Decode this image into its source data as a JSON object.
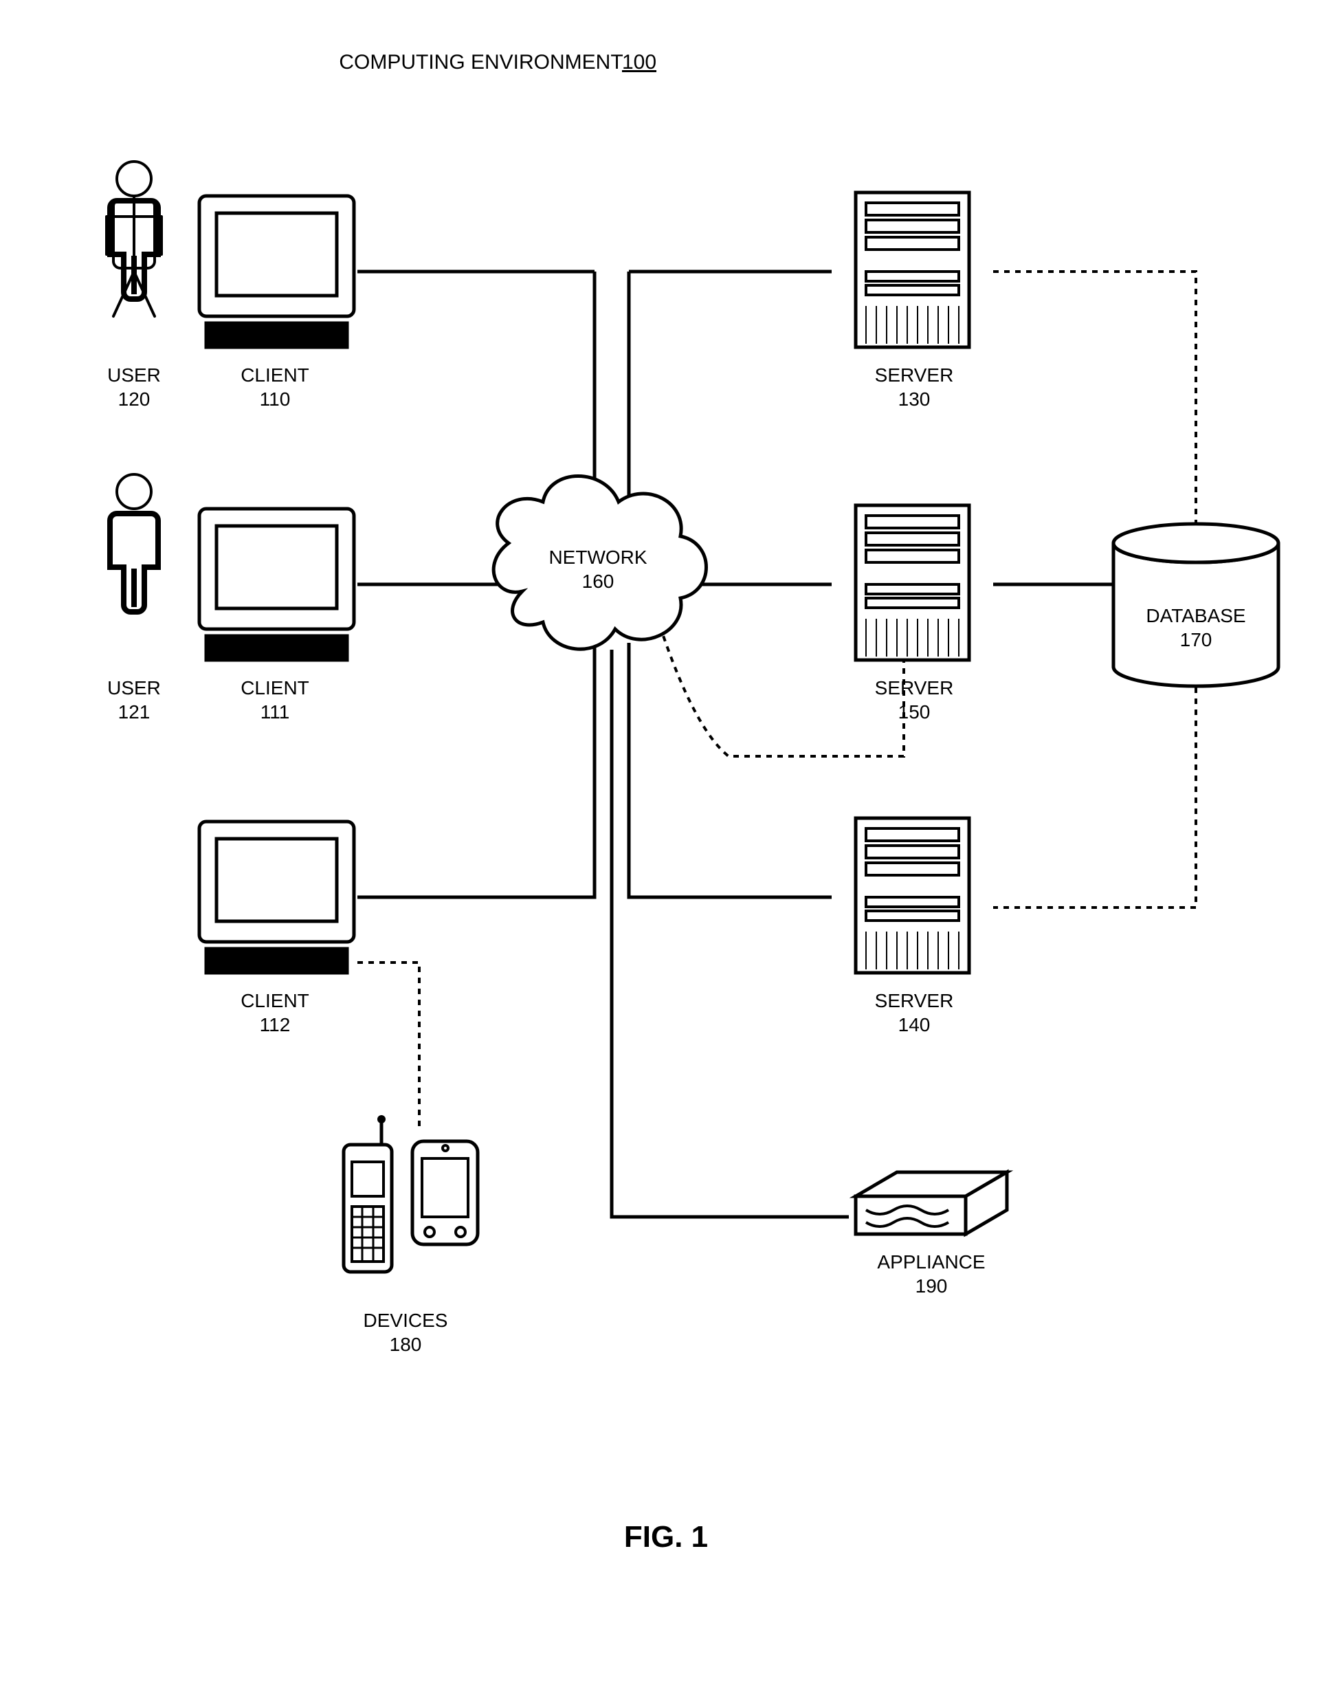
{
  "title_prefix": "COMPUTING ENVIRONMENT",
  "title_num": "100",
  "figure_label": "FIG. 1",
  "user120": {
    "label": "USER",
    "num": "120"
  },
  "user121": {
    "label": "USER",
    "num": "121"
  },
  "client110": {
    "label": "CLIENT",
    "num": "110"
  },
  "client111": {
    "label": "CLIENT",
    "num": "111"
  },
  "client112": {
    "label": "CLIENT",
    "num": "112"
  },
  "network": {
    "label": "NETWORK",
    "num": "160"
  },
  "server130": {
    "label": "SERVER",
    "num": "130"
  },
  "server150": {
    "label": "SERVER",
    "num": "150"
  },
  "server140": {
    "label": "SERVER",
    "num": "140"
  },
  "database": {
    "label": "DATABASE",
    "num": "170"
  },
  "appliance": {
    "label": "APPLIANCE",
    "num": "190"
  },
  "devices": {
    "label": "DEVICES",
    "num": "180"
  }
}
